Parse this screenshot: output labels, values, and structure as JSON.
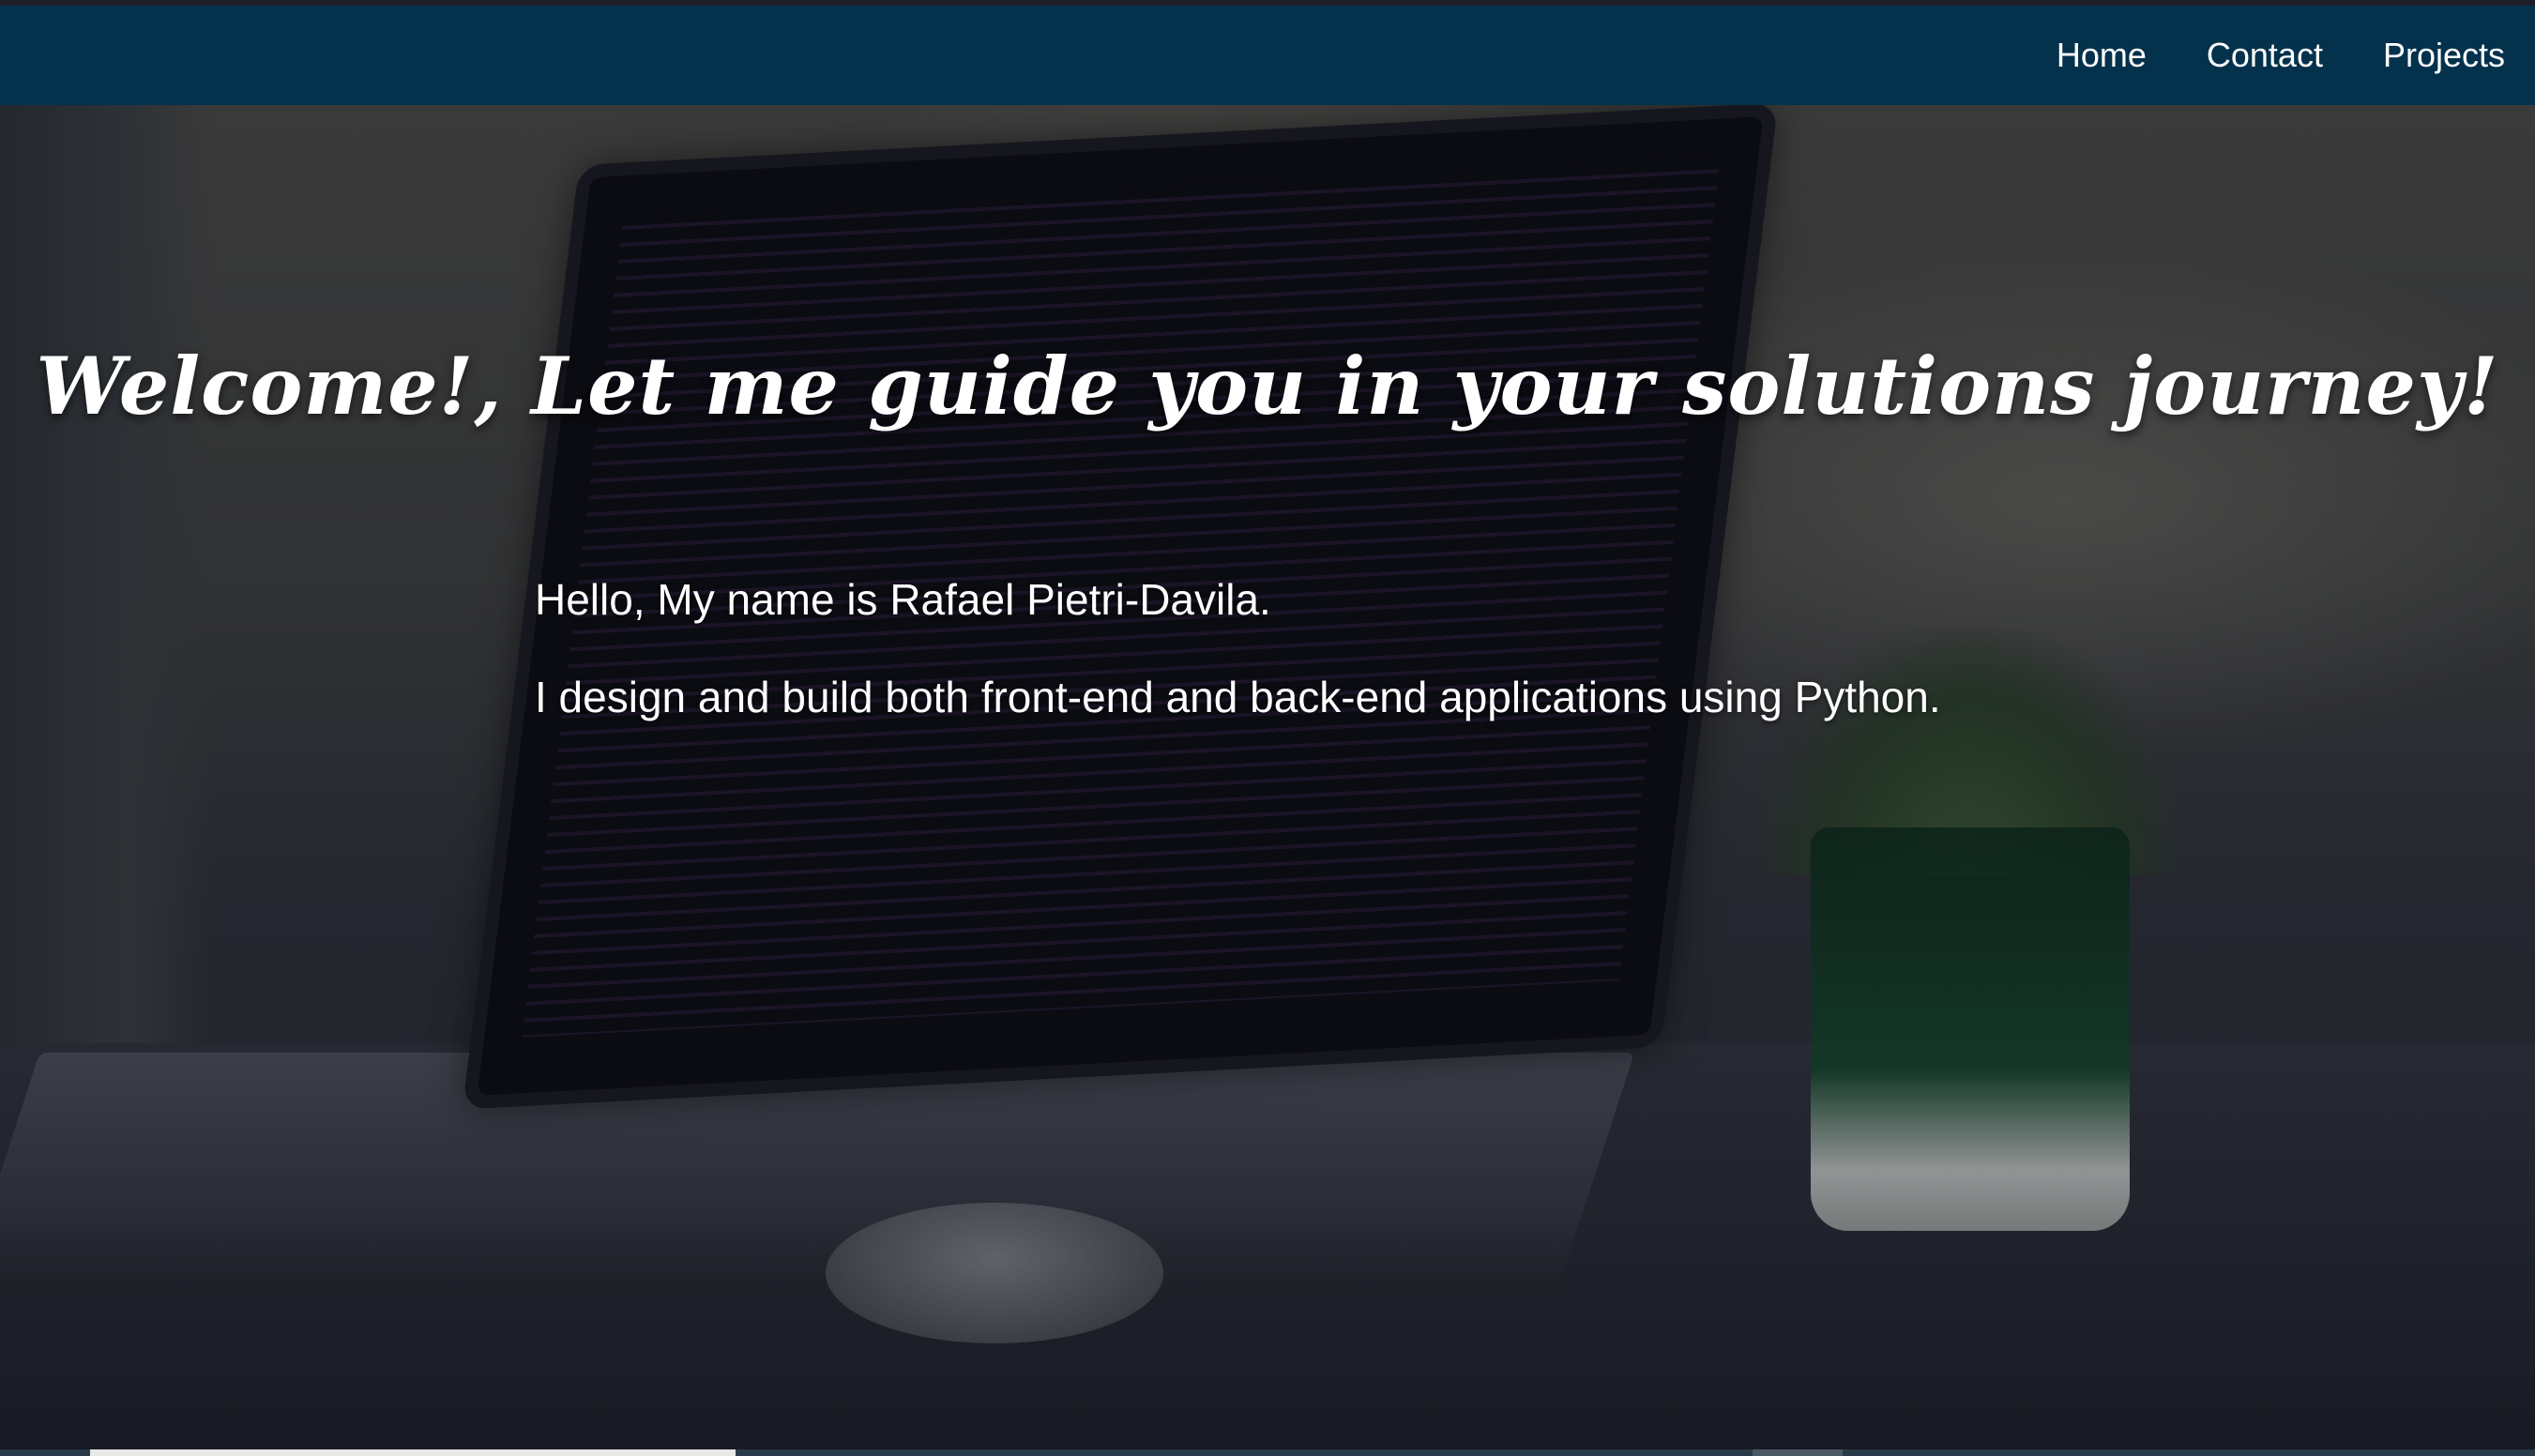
{
  "nav": {
    "items": [
      {
        "label": "Home"
      },
      {
        "label": "Contact"
      },
      {
        "label": "Projects"
      }
    ]
  },
  "hero": {
    "heading": "Welcome!, Let me guide you in your solutions journey!",
    "intro": "Hello, My name is Rafael Pietri-Davila.",
    "description": "I design and build both front-end and back-end applications using Python."
  },
  "colors": {
    "navbar": "#04324c",
    "text": "#ffffff"
  }
}
